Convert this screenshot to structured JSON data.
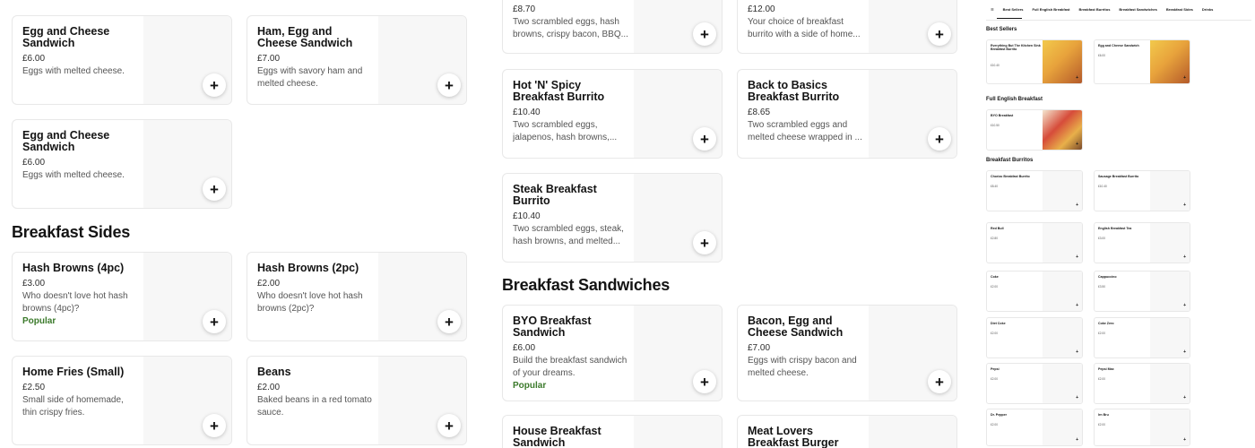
{
  "add_icon": "+",
  "col1": {
    "cards_top": [
      {
        "title": "Egg and Cheese Sandwich",
        "price": "£6.00",
        "desc": "Eggs with melted cheese.",
        "popular": ""
      },
      {
        "title": "Ham, Egg and Cheese Sandwich",
        "price": "£7.00",
        "desc": "Eggs with savory ham and melted cheese.",
        "popular": ""
      },
      {
        "title": "Egg and Cheese Sandwich",
        "price": "£6.00",
        "desc": "Eggs with melted cheese.",
        "popular": ""
      }
    ],
    "sides_heading": "Breakfast Sides",
    "sides": [
      {
        "title": "Hash Browns (4pc)",
        "price": "£3.00",
        "desc": "Who doesn't love hot hash browns (4pc)?",
        "popular": "Popular"
      },
      {
        "title": "Hash Browns (2pc)",
        "price": "£2.00",
        "desc": "Who doesn't love hot hash browns (2pc)?",
        "popular": ""
      },
      {
        "title": "Home Fries (Small)",
        "price": "£2.50",
        "desc": "Small side of homemade, thin crispy fries.",
        "popular": ""
      },
      {
        "title": "Beans",
        "price": "£2.00",
        "desc": "Baked beans in a red tomato sauce.",
        "popular": ""
      }
    ]
  },
  "col2": {
    "burritos": [
      {
        "title": "",
        "price": "£8.70",
        "desc": "Two scrambled eggs, hash browns, crispy bacon, BBQ...",
        "popular": ""
      },
      {
        "title": "",
        "price": "£12.00",
        "desc": "Your choice of breakfast burrito with a side of home...",
        "popular": ""
      },
      {
        "title": "Hot 'N' Spicy Breakfast Burrito",
        "price": "£10.40",
        "desc": "Two scrambled eggs, jalapenos, hash browns,...",
        "popular": ""
      },
      {
        "title": "Back to Basics Breakfast Burrito",
        "price": "£8.65",
        "desc": "Two scrambled eggs and melted cheese wrapped in ...",
        "popular": ""
      },
      {
        "title": "Steak Breakfast Burrito",
        "price": "£10.40",
        "desc": "Two scrambled eggs, steak, hash browns, and melted...",
        "popular": ""
      }
    ],
    "sandwiches_heading": "Breakfast Sandwiches",
    "sandwiches": [
      {
        "title": "BYO Breakfast Sandwich",
        "price": "£6.00",
        "desc": "Build the breakfast sandwich of your dreams.",
        "popular": "Popular"
      },
      {
        "title": "Bacon, Egg and Cheese Sandwich",
        "price": "£7.00",
        "desc": "Eggs with crispy bacon and melted cheese.",
        "popular": ""
      },
      {
        "title": "House Breakfast Sandwich",
        "price": "",
        "desc": "",
        "popular": ""
      },
      {
        "title": "Meat Lovers Breakfast Burger",
        "price": "",
        "desc": "",
        "popular": ""
      }
    ]
  },
  "minimap": {
    "tabs": [
      "Best Sellers",
      "Full English Breakfast",
      "Breakfast Burritos",
      "Breakfast Sandwiches",
      "Breakfast Sides",
      "Drinks"
    ],
    "best_sellers_heading": "Best Sellers",
    "full_english_heading": "Full English Breakfast",
    "burritos_heading": "Breakfast Burritos",
    "cards": [
      {
        "title": "Everything But The Kitchen Sink Breakfast Burrito",
        "price": "£10.40",
        "img": "food"
      },
      {
        "title": "Egg and Cheese Sandwich",
        "price": "£6.00",
        "img": "food"
      },
      {
        "title": "BYO Breakfast",
        "price": "£10.50",
        "img": "plate"
      },
      {
        "title": "Chorizo Breakfast Burrito",
        "price": "£8.40",
        "img": ""
      },
      {
        "title": "Sausage Breakfast Burrito",
        "price": "£10.40",
        "img": ""
      },
      {
        "title": "Red Bull",
        "price": "£2.80",
        "img": ""
      },
      {
        "title": "English Breakfast Tea",
        "price": "£3.00",
        "img": ""
      },
      {
        "title": "Coke",
        "price": "£2.00",
        "img": ""
      },
      {
        "title": "Cappuccino",
        "price": "£3.50",
        "img": ""
      },
      {
        "title": "Diet Coke",
        "price": "£2.00",
        "img": ""
      },
      {
        "title": "Coke Zero",
        "price": "£2.00",
        "img": ""
      },
      {
        "title": "Pepsi",
        "price": "£2.00",
        "img": ""
      },
      {
        "title": "Pepsi Max",
        "price": "£2.00",
        "img": ""
      },
      {
        "title": "Dr. Pepper",
        "price": "£2.00",
        "img": ""
      },
      {
        "title": "Irn Bru",
        "price": "£2.00",
        "img": ""
      }
    ]
  }
}
